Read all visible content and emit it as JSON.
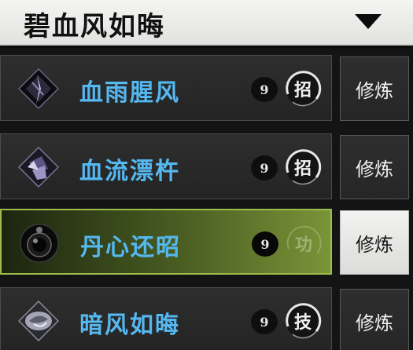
{
  "header": {
    "title": "碧血风如晦",
    "dropdown_icon": "triangle-down-icon"
  },
  "skills": [
    {
      "name": "血雨腥风",
      "level": "9",
      "type": "招",
      "action": "修炼",
      "icon": "shadow-diamond-icon",
      "selected": false
    },
    {
      "name": "血流漂杵",
      "level": "9",
      "type": "招",
      "action": "修炼",
      "icon": "violet-shards-icon",
      "selected": false
    },
    {
      "name": "丹心还昭",
      "level": "9",
      "type": "功",
      "action": "修炼",
      "icon": "dark-orb-icon",
      "selected": true
    },
    {
      "name": "暗风如晦",
      "level": "9",
      "type": "技",
      "action": "修炼",
      "icon": "grey-vortex-icon",
      "selected": false
    }
  ],
  "colors": {
    "skill_name": "#55b8f0",
    "selected_border": "#9dbd4a",
    "selected_bg": "#4a5e22"
  }
}
